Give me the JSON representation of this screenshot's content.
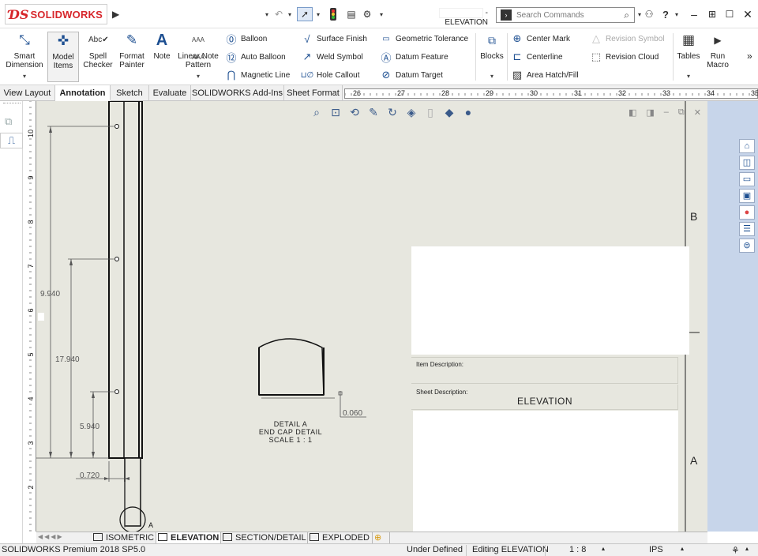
{
  "titlebar": {
    "app_logo": "SOLIDWORKS",
    "document_title": "- ELEVATION",
    "search_placeholder": "Search Commands",
    "icons": [
      "rebuild-icon",
      "undo-icon",
      "select-icon",
      "traffic-light-icon",
      "file-properties-icon",
      "options-icon",
      "user-icon",
      "help-icon"
    ]
  },
  "ribbon": {
    "smart_dimension": "Smart Dimension",
    "model_items": "Model Items",
    "spell_checker": "Spell Checker",
    "format_painter": "Format Painter",
    "note": "Note",
    "linear_note_pattern": "Linear Note Pattern",
    "balloon": "Balloon",
    "auto_balloon": "Auto Balloon",
    "magnetic_line": "Magnetic Line",
    "surface_finish": "Surface Finish",
    "weld_symbol": "Weld Symbol",
    "hole_callout": "Hole Callout",
    "geometric_tolerance": "Geometric Tolerance",
    "datum_feature": "Datum Feature",
    "datum_target": "Datum Target",
    "blocks": "Blocks",
    "center_mark": "Center Mark",
    "centerline": "Centerline",
    "area_hatch_fill": "Area Hatch/Fill",
    "revision_symbol": "Revision Symbol",
    "revision_cloud": "Revision Cloud",
    "tables": "Tables",
    "run_macro": "Run Macro",
    "more": "»"
  },
  "tabs": [
    "View Layout",
    "Annotation",
    "Sketch",
    "Evaluate",
    "SOLIDWORKS Add-Ins",
    "Sheet Format"
  ],
  "active_tab": "Annotation",
  "ruler_h": [
    "26",
    "27",
    "28",
    "29",
    "30",
    "31",
    "32",
    "33",
    "34",
    "35"
  ],
  "ruler_v": [
    "10",
    "9",
    "8",
    "7",
    "6",
    "5",
    "4",
    "3",
    "2"
  ],
  "drawing": {
    "dims": [
      "9.940",
      "17.940",
      "5.940",
      "0.720",
      "0.060"
    ],
    "detail_label": "A",
    "detail_lines": [
      "DETAIL A",
      "END CAP DETAIL",
      "SCALE 1 : 1"
    ],
    "zone_b": "B",
    "zone_a": "A"
  },
  "title_block": {
    "item_description_label": "Item Description:",
    "sheet_description_label": "Sheet Description:",
    "sheet_description_value": "ELEVATION"
  },
  "sheet_tabs": [
    "ISOMETRIC",
    "ELEVATION",
    "SECTION/DETAIL",
    "EXPLODED"
  ],
  "active_sheet": "ELEVATION",
  "status": {
    "product": "SOLIDWORKS Premium 2018 SP5.0",
    "state": "Under Defined",
    "editing": "Editing ELEVATION",
    "scale": "1 : 8",
    "units": "IPS"
  },
  "colors": {
    "accent": "#d7262b",
    "canvas": "#e7e7df",
    "task_pane": "#c7d5ea"
  }
}
